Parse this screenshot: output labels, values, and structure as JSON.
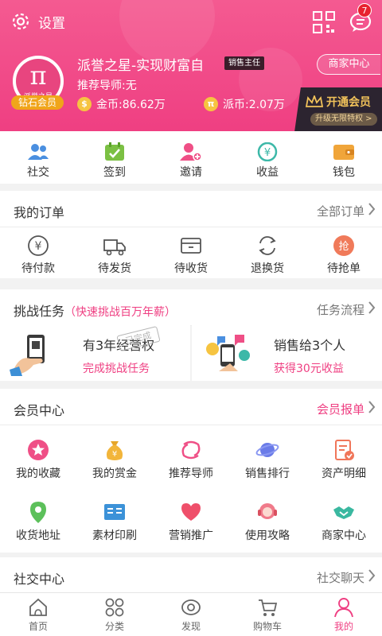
{
  "header": {
    "settings_label": "设置",
    "message_badge": "7",
    "avatar_text": "派誉之星",
    "avatar_glyph": "π",
    "level_badge": "钻石会员",
    "user_name": "派誉之星-实现财富自",
    "role_tag": "销售主任",
    "mentor": "推荐导师:无",
    "gold_coin_label": "金币:86.62万",
    "pai_coin_label": "派币:2.07万",
    "coin_glyph": "$",
    "pai_glyph": "π",
    "merchant_center": "商家中心",
    "vip_title": "开通会员",
    "vip_sub": "升级无限特权 >",
    "accent": "#ef3f82"
  },
  "quick": [
    {
      "label": "社交",
      "icon": "people-icon"
    },
    {
      "label": "签到",
      "icon": "calendar-check-icon"
    },
    {
      "label": "邀请",
      "icon": "add-user-icon"
    },
    {
      "label": "收益",
      "icon": "earnings-icon"
    },
    {
      "label": "钱包",
      "icon": "wallet-icon"
    }
  ],
  "orders": {
    "title": "我的订单",
    "more": "全部订单",
    "items": [
      {
        "label": "待付款",
        "icon": "yuan-circle-icon"
      },
      {
        "label": "待发货",
        "icon": "truck-icon"
      },
      {
        "label": "待收货",
        "icon": "box-icon"
      },
      {
        "label": "退换货",
        "icon": "exchange-icon"
      },
      {
        "label": "待抢单",
        "icon": "grab-order-icon",
        "glyph": "抢"
      }
    ]
  },
  "tasks": {
    "title": "挑战任务",
    "subtitle": "（快速挑战百万年薪）",
    "more": "任务流程",
    "cards": [
      {
        "title": "有3年经营权",
        "sub": "完成挑战任务",
        "stamp": "已完成"
      },
      {
        "title": "销售给3个人",
        "sub": "获得30元收益"
      }
    ]
  },
  "members": {
    "title": "会员中心",
    "more": "会员报单",
    "items": [
      {
        "label": "我的收藏",
        "icon": "favorite-star-icon"
      },
      {
        "label": "我的赏金",
        "icon": "money-bag-icon",
        "glyph": "¥"
      },
      {
        "label": "推荐导师",
        "icon": "mentor-icon"
      },
      {
        "label": "销售排行",
        "icon": "planet-ranking-icon"
      },
      {
        "label": "资产明细",
        "icon": "asset-detail-icon"
      },
      {
        "label": "收货地址",
        "icon": "location-pin-icon"
      },
      {
        "label": "素材印刷",
        "icon": "print-material-icon"
      },
      {
        "label": "营销推广",
        "icon": "heart-icon"
      },
      {
        "label": "使用攻略",
        "icon": "support-agent-icon"
      },
      {
        "label": "商家中心",
        "icon": "handshake-icon"
      }
    ]
  },
  "social": {
    "title": "社交中心",
    "more": "社交聊天"
  },
  "tabs": [
    {
      "label": "首页",
      "icon": "home-icon"
    },
    {
      "label": "分类",
      "icon": "category-icon"
    },
    {
      "label": "发现",
      "icon": "discover-eye-icon"
    },
    {
      "label": "购物车",
      "icon": "cart-icon"
    },
    {
      "label": "我的",
      "icon": "profile-icon",
      "active": true
    }
  ]
}
